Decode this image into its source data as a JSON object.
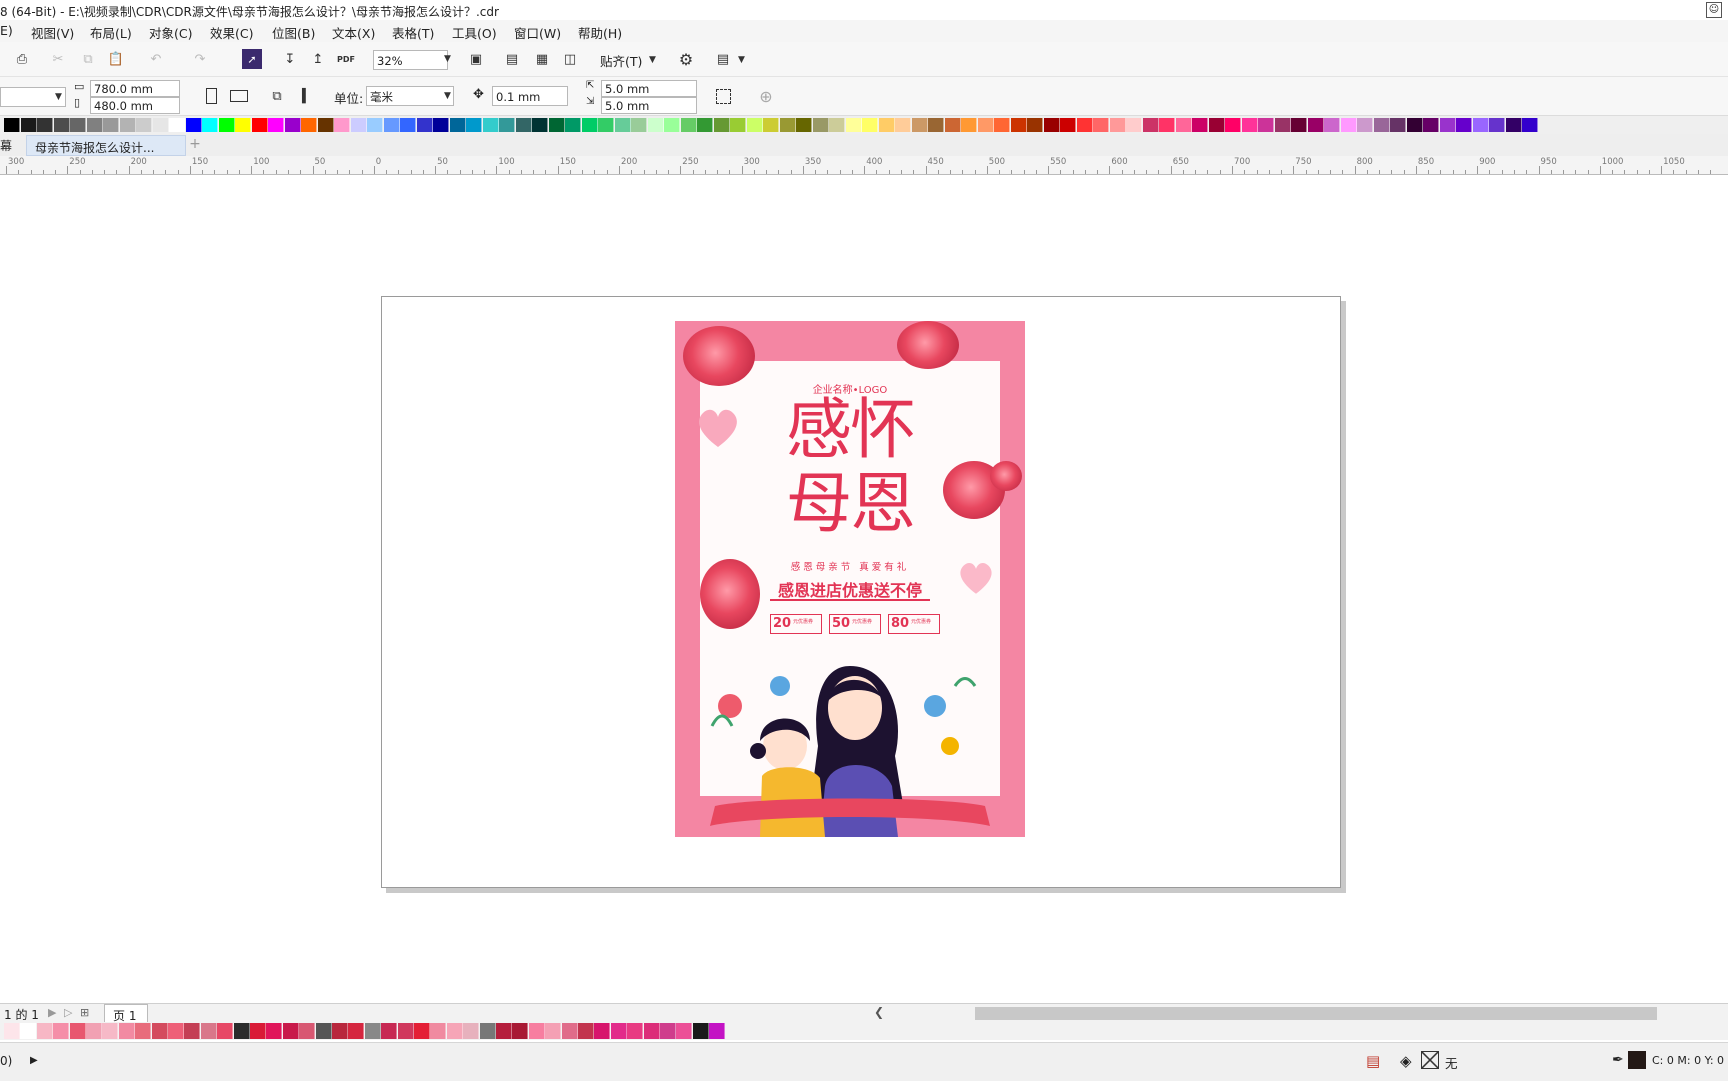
{
  "window": {
    "title": "8 (64-Bit) - E:\\视频录制\\CDR\\CDR源文件\\母亲节海报怎么设计？\\母亲节海报怎么设计？.cdr"
  },
  "menu": {
    "items": [
      "E)",
      "视图(V)",
      "布局(L)",
      "对象(C)",
      "效果(C)",
      "位图(B)",
      "文本(X)",
      "表格(T)",
      "工具(O)",
      "窗口(W)",
      "帮助(H)"
    ]
  },
  "toolbar": {
    "zoom_value": "32%",
    "snap_label": "贴齐(T)",
    "pdf_label": "PDF"
  },
  "propertybar": {
    "width": "780.0 mm",
    "height": "480.0 mm",
    "unit_label": "单位:",
    "unit_value": "毫米",
    "nudge": "0.1 mm",
    "dup_x": "5.0 mm",
    "dup_y": "5.0 mm"
  },
  "palette": {
    "colors": [
      "#000000",
      "#1a1a1a",
      "#333333",
      "#4d4d4d",
      "#666666",
      "#808080",
      "#999999",
      "#b3b3b3",
      "#cccccc",
      "#e6e6e6",
      "#ffffff",
      "#0000ff",
      "#00ffff",
      "#00ff00",
      "#ffff00",
      "#ff0000",
      "#ff00ff",
      "#9900cc",
      "#ff6600",
      "#663300",
      "#ff99cc",
      "#ccccff",
      "#99ccff",
      "#6699ff",
      "#3366ff",
      "#3333cc",
      "#000099",
      "#006699",
      "#0099cc",
      "#33cccc",
      "#339999",
      "#336666",
      "#003333",
      "#006633",
      "#009966",
      "#00cc66",
      "#33cc66",
      "#66cc99",
      "#99cc99",
      "#ccffcc",
      "#99ff99",
      "#66cc66",
      "#339933",
      "#669933",
      "#99cc33",
      "#ccff66",
      "#cccc33",
      "#999933",
      "#666600",
      "#999966",
      "#cccc99",
      "#ffff99",
      "#ffff66",
      "#ffcc66",
      "#ffcc99",
      "#cc9966",
      "#996633",
      "#cc6633",
      "#ff9933",
      "#ff9966",
      "#ff6633",
      "#cc3300",
      "#993300",
      "#990000",
      "#cc0000",
      "#ff3333",
      "#ff6666",
      "#ff9999",
      "#ffcccc",
      "#cc3366",
      "#ff3366",
      "#ff6699",
      "#cc0066",
      "#990033",
      "#ff0066",
      "#ff3399",
      "#cc3399",
      "#993366",
      "#660033",
      "#990066",
      "#cc66cc",
      "#ff99ff",
      "#cc99cc",
      "#996699",
      "#663366",
      "#330033",
      "#660066",
      "#9933cc",
      "#6600cc",
      "#9966ff",
      "#6633cc",
      "#330066",
      "#3300cc"
    ]
  },
  "doc_tabs": {
    "left_label": "幕",
    "active_tab": "母亲节海报怎么设计...",
    "add_tab": "+"
  },
  "ruler": {
    "labels": [
      "300",
      "250",
      "200",
      "150",
      "100",
      "50",
      "0",
      "50",
      "100",
      "150",
      "200",
      "250",
      "300",
      "350",
      "400",
      "450",
      "500",
      "550",
      "600",
      "650",
      "700",
      "750",
      "800",
      "850",
      "900",
      "950",
      "1000",
      "1050"
    ]
  },
  "poster": {
    "company": "企业名称•LOGO",
    "headline_1": "感怀",
    "headline_2": "母恩",
    "tagline": "感恩母亲节  真爱有礼",
    "promo": "感恩进店优惠送不停",
    "coupons": [
      {
        "value": "20",
        "text": "元优惠券"
      },
      {
        "value": "50",
        "text": "元优惠券"
      },
      {
        "value": "80",
        "text": "元优惠券"
      }
    ],
    "colors": {
      "border": "#f486a3",
      "inner": "#fffafa",
      "accent": "#e23454"
    }
  },
  "page_nav": {
    "page_info": "1 的 1",
    "page_tab": "页 1"
  },
  "bottom_palette": {
    "colors": [
      "#fde5ea",
      "#ffffff",
      "#f7b7c5",
      "#f58ea8",
      "#e8576f",
      "#f1a1b3",
      "#f6b9c7",
      "#f28aa2",
      "#e86c7c",
      "#d44b5e",
      "#ee5f78",
      "#c43f55",
      "#d9778a",
      "#e74866",
      "#2b2b2b",
      "#d91a36",
      "#e0155a",
      "#c8194a",
      "#d85872",
      "#555555",
      "#b8273d",
      "#d5263f",
      "#888888",
      "#c72853",
      "#d0385d",
      "#e41e35",
      "#f08aa0",
      "#f6a5b7",
      "#e7b1bd",
      "#777777",
      "#b51e3c",
      "#a81934",
      "#f77ea0",
      "#f4a0b4",
      "#e06c8a",
      "#c2344e",
      "#d7156c",
      "#e22b8a",
      "#e83a82",
      "#dc2d79",
      "#cf3d8c",
      "#ec4f97",
      "#1a1a1a",
      "#c313c4"
    ]
  },
  "status": {
    "fill_label": "无",
    "color_readout": "C: 0 M: 0 Y: 0 K",
    "left_indicator": "0)"
  }
}
